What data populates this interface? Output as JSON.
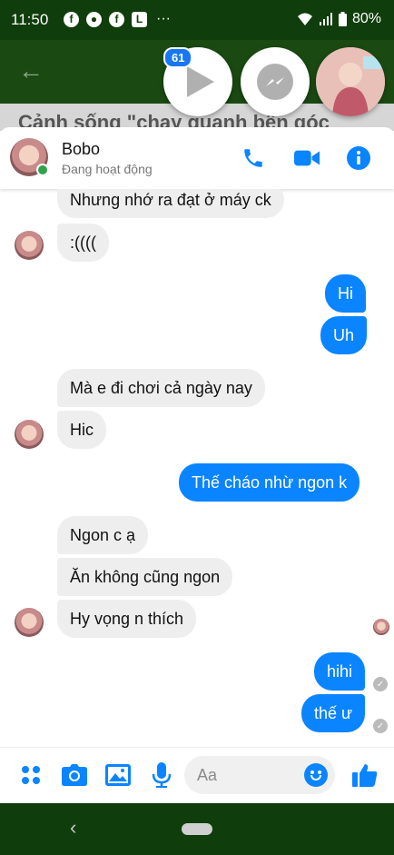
{
  "status_bar": {
    "time": "11:50",
    "battery": "80%",
    "more": "···",
    "icons": [
      "facebook-icon",
      "person-icon",
      "facebook-icon",
      "l-app-icon",
      "wifi-icon",
      "signal-icon",
      "battery-icon"
    ]
  },
  "background_page": {
    "title": "Cảnh sống \"chạy quanh bến góc"
  },
  "chat_heads": {
    "badge": "61"
  },
  "header": {
    "name": "Bobo",
    "status": "Đang hoạt động"
  },
  "messages": [
    {
      "side": "in",
      "text": "Nhưng nhớ ra đạt ở máy ck"
    },
    {
      "side": "in",
      "text": ":(((("
    },
    {
      "side": "out",
      "text": "Hi"
    },
    {
      "side": "out",
      "text": "Uh"
    },
    {
      "side": "in",
      "text": "Mà e đi chơi cả ngày nay"
    },
    {
      "side": "in",
      "text": "Hic"
    },
    {
      "side": "out",
      "text": "Thế cháo nhừ ngon k"
    },
    {
      "side": "in",
      "text": "Ngon c ạ"
    },
    {
      "side": "in",
      "text": "Ăn không cũng ngon"
    },
    {
      "side": "in",
      "text": "Hy vọng n thích"
    },
    {
      "side": "out",
      "text": "hihi"
    },
    {
      "side": "out",
      "text": "thế ư"
    }
  ],
  "composer": {
    "placeholder": "Aa"
  },
  "colors": {
    "accent": "#0a84ff",
    "online": "#31a24c",
    "status_bar_bg": "#0f3d0b"
  }
}
